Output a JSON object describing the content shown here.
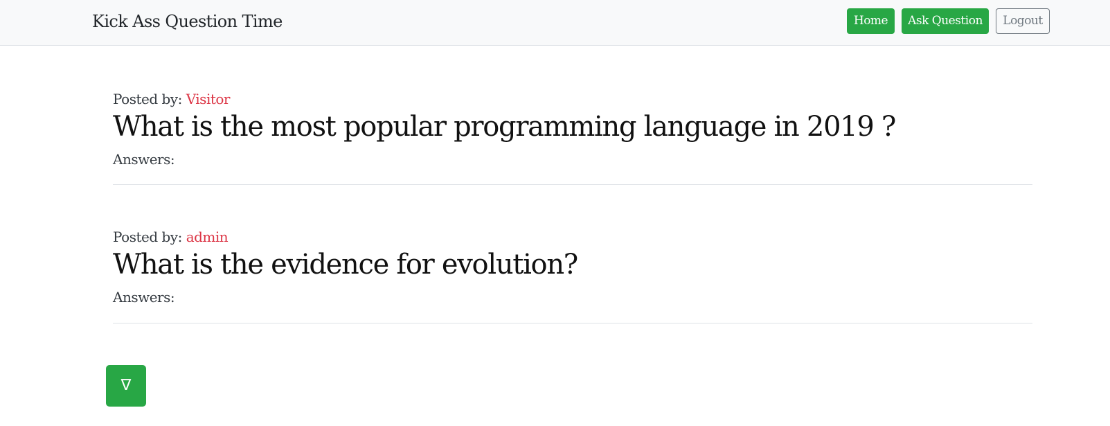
{
  "navbar": {
    "brand": "Kick Ass Question Time",
    "buttons": {
      "home": "Home",
      "ask": "Ask Question",
      "logout": "Logout"
    }
  },
  "questions": [
    {
      "posted_by_label": "Posted by:",
      "author": "Visitor",
      "title": "What is the most popular programming language in 2019 ?",
      "answers_label": "Answers:"
    },
    {
      "posted_by_label": "Posted by:",
      "author": "admin",
      "title": "What is the evidence for evolution?",
      "answers_label": "Answers:"
    }
  ],
  "scroll_button": {
    "icon": "nabla-down-arrow-icon",
    "glyph": "∇"
  },
  "colors": {
    "accent_green": "#28a745",
    "author_red": "#dc3545",
    "navbar_bg": "#f8f9fa",
    "outline_gray": "#6c757d"
  }
}
